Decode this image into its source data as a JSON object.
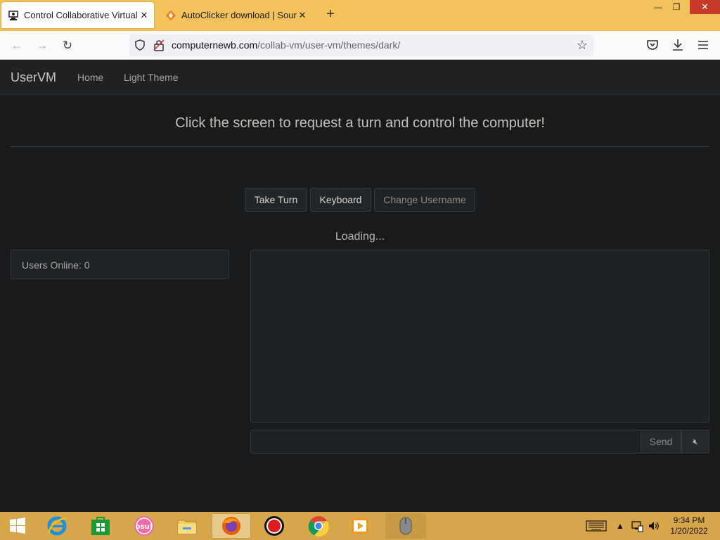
{
  "browser": {
    "tabs": [
      {
        "title": "Control Collaborative Virtual M",
        "active": true,
        "icon": "vm-favicon"
      },
      {
        "title": "AutoClicker download | Source",
        "active": false,
        "icon": "sourceforge-icon"
      }
    ],
    "url_domain": "computernewb.com",
    "url_path": "/collab-vm/user-vm/themes/dark/"
  },
  "site": {
    "brand": "UserVM",
    "nav": [
      "Home",
      "Light Theme"
    ],
    "headline": "Click the screen to request a turn and control the computer!",
    "buttons": {
      "take_turn": "Take Turn",
      "keyboard": "Keyboard",
      "change_username": "Change Username"
    },
    "loading": "Loading...",
    "users_online": "Users Online: 0",
    "chat": {
      "input_value": "",
      "send_label": "Send"
    }
  },
  "taskbar": {
    "apps": [
      "start-button",
      "internet-explorer-icon",
      "store-icon",
      "osu-icon",
      "file-explorer-icon",
      "firefox-icon",
      "record-icon",
      "chrome-icon",
      "media-player-icon",
      "mouse-app-icon"
    ],
    "time": "9:34 PM",
    "date": "1/20/2022"
  },
  "colors": {
    "tabstrip": "#f3c25a",
    "page_bg": "#181a1b",
    "taskbar": "#d7a64a"
  }
}
